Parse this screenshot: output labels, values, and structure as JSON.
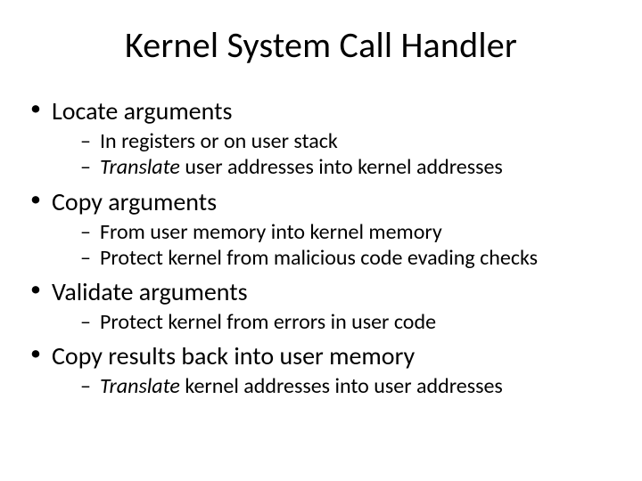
{
  "title": "Kernel System Call Handler",
  "bullets": [
    {
      "text": "Locate arguments",
      "sub": [
        {
          "text": "In registers or on user stack"
        },
        {
          "em": "Translate",
          "rest": " user addresses into kernel addresses"
        }
      ]
    },
    {
      "text": "Copy arguments",
      "sub": [
        {
          "text": "From user memory into kernel memory"
        },
        {
          "text": "Protect kernel from malicious code evading checks"
        }
      ]
    },
    {
      "text": "Validate arguments",
      "sub": [
        {
          "text": "Protect kernel from errors in user code"
        }
      ]
    },
    {
      "text": "Copy results back into user memory",
      "sub": [
        {
          "em": "Translate",
          "rest": " kernel addresses into user addresses"
        }
      ]
    }
  ]
}
